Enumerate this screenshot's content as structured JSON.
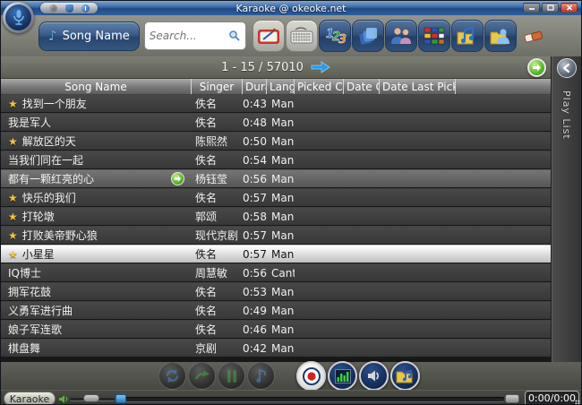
{
  "window": {
    "title": "Karaoke @ okeoke.net",
    "controls": [
      "minimize",
      "maximize",
      "close"
    ],
    "logo_icon": "microphone-icon",
    "quick_icons": [
      "record-indicator-icon",
      "settings-shield-icon",
      "info-icon"
    ]
  },
  "toolbar": {
    "song_name_button": {
      "label": "Song Name",
      "icon": "music-note-icon"
    },
    "search": {
      "placeholder": "Search...",
      "icon": "search-icon"
    },
    "buttons": [
      {
        "name": "handwriting-pad",
        "style": "light"
      },
      {
        "name": "keyboard",
        "style": "light"
      },
      {
        "name": "numbers-123",
        "style": "dark",
        "text": "123"
      },
      {
        "name": "song-cards",
        "style": "dark"
      },
      {
        "name": "singers",
        "style": "dark"
      },
      {
        "name": "languages-flags",
        "style": "dark"
      },
      {
        "name": "note-folder",
        "style": "dark"
      },
      {
        "name": "person-folder",
        "style": "dark"
      }
    ],
    "eraser_icon": "eraser-icon"
  },
  "pagination": {
    "text": "1  -  15 / 57010",
    "next_icon": "blue-arrow-right-icon",
    "go_icon": "green-arrow-right-icon"
  },
  "table": {
    "columns": [
      "Song Name",
      "Singer",
      "Durat",
      "Langu",
      "Picked Co",
      "Date Crea",
      "Date Last Pick"
    ],
    "star_glyph": "★",
    "rows": [
      {
        "star": true,
        "name": "找到一个朋友",
        "singer": "佚名",
        "duration": "0:43",
        "language": "Man"
      },
      {
        "star": false,
        "name": "我是军人",
        "singer": "佚名",
        "duration": "0:48",
        "language": "Man"
      },
      {
        "star": true,
        "name": "解放区的天",
        "singer": "陈熙然",
        "duration": "0:50",
        "language": "Man"
      },
      {
        "star": false,
        "name": "当我们同在一起",
        "singer": "佚名",
        "duration": "0:54",
        "language": "Man"
      },
      {
        "star": false,
        "name": "都有一颗红亮的心",
        "singer": "杨钰莹",
        "duration": "0:56",
        "language": "Man",
        "hovered": true,
        "play_icon": true
      },
      {
        "star": true,
        "name": "快乐的我们",
        "singer": "佚名",
        "duration": "0:57",
        "language": "Man"
      },
      {
        "star": true,
        "name": "打轮墩",
        "singer": "郭颂",
        "duration": "0:58",
        "language": "Man"
      },
      {
        "star": true,
        "name": "打败美帝野心狼",
        "singer": "现代京剧",
        "duration": "0:57",
        "language": "Man"
      },
      {
        "star": true,
        "name": "小星星",
        "singer": "佚名",
        "duration": "0:57",
        "language": "Man",
        "selected": true
      },
      {
        "star": false,
        "name": "IQ博士",
        "singer": "周慧敏",
        "duration": "0:56",
        "language": "Cant"
      },
      {
        "star": false,
        "name": "拥军花鼓",
        "singer": "佚名",
        "duration": "0:53",
        "language": "Man"
      },
      {
        "star": false,
        "name": "义勇军进行曲",
        "singer": "佚名",
        "duration": "0:49",
        "language": "Man"
      },
      {
        "star": false,
        "name": "娘子军连歌",
        "singer": "佚名",
        "duration": "0:46",
        "language": "Man"
      },
      {
        "star": false,
        "name": "棋盘舞",
        "singer": "京剧",
        "duration": "0:42",
        "language": "Man"
      }
    ]
  },
  "sidebar": {
    "label": "Play List",
    "collapse_icon": "chevron-left-icon"
  },
  "player": {
    "buttons": [
      {
        "name": "repeat",
        "disabled": true
      },
      {
        "name": "next-song",
        "disabled": true
      },
      {
        "name": "pause",
        "disabled": true
      },
      {
        "name": "melody",
        "disabled": true
      },
      {
        "name": "record",
        "disabled": false
      },
      {
        "name": "equalizer",
        "disabled": false
      },
      {
        "name": "speaker",
        "disabled": false
      },
      {
        "name": "music-folder",
        "disabled": false
      }
    ],
    "source_label": "Karaoke",
    "time": "0:00/0:00"
  },
  "colors": {
    "titlebar_blue": "#2e5f9e",
    "button_navy": "#33517d",
    "row_dark": "#3f3f3f",
    "selected_row": "#e3e3e3",
    "star_gold": "#f2c43c",
    "go_green": "#58b52a",
    "arrow_blue": "#2e9be6"
  }
}
